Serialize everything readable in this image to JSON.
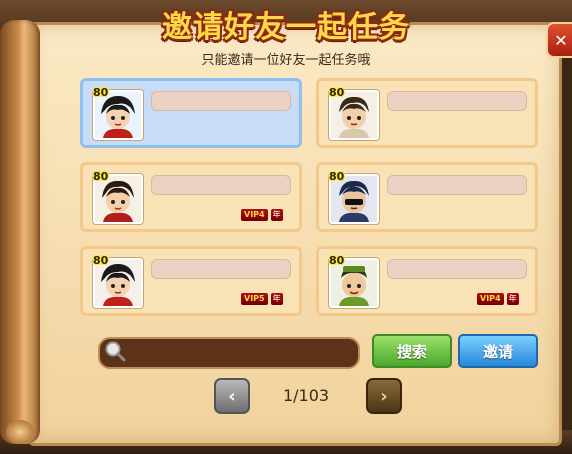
{
  "dialog": {
    "title": "邀请好友一起任务",
    "subtitle": "只能邀请一位好友一起任务哦",
    "close_label": "✕"
  },
  "friends": [
    {
      "level": "80",
      "vip": false,
      "selected": true
    },
    {
      "level": "80",
      "vip": false,
      "selected": false
    },
    {
      "level": "80",
      "vip": true,
      "vip_label": "VIP4",
      "year_label": "年",
      "selected": false
    },
    {
      "level": "80",
      "vip": false,
      "selected": false
    },
    {
      "level": "80",
      "vip": true,
      "vip_label": "VIP5",
      "year_label": "年",
      "selected": false
    },
    {
      "level": "80",
      "vip": true,
      "vip_label": "VIP4",
      "year_label": "年",
      "selected": false
    }
  ],
  "search": {
    "placeholder": "",
    "search_button": "搜索",
    "invite_button": "邀请"
  },
  "pager": {
    "page_text": "1/103",
    "prev_icon": "chevron-left-icon",
    "next_icon": "chevron-right-icon"
  }
}
